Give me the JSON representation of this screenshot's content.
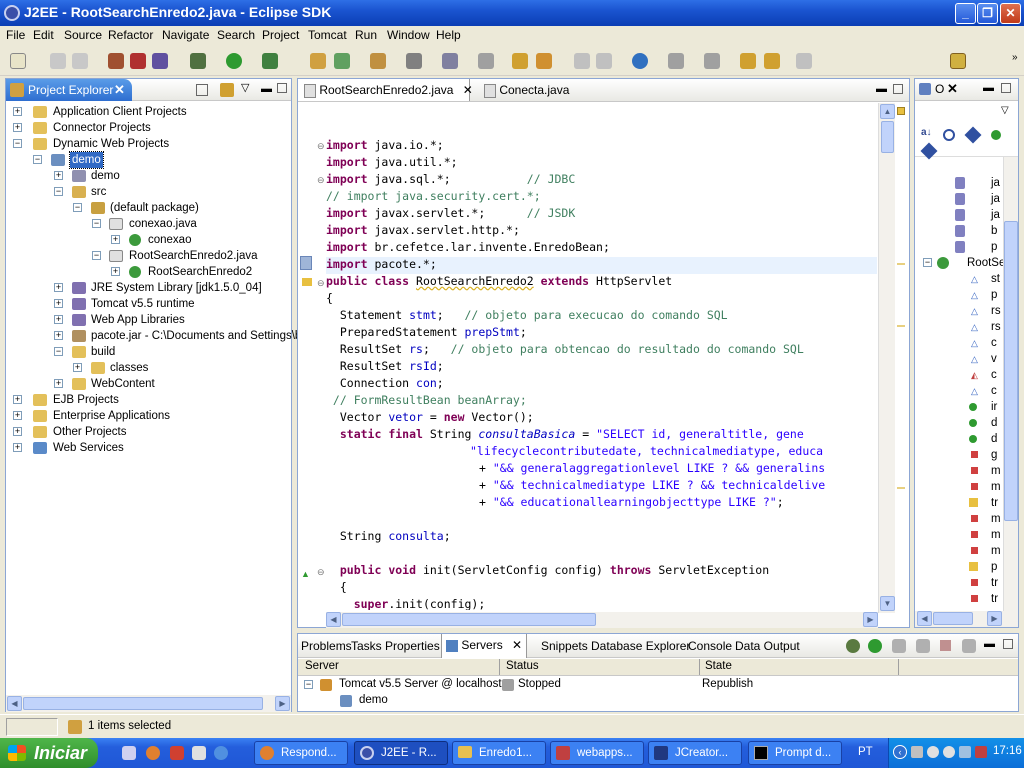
{
  "window": {
    "title": "J2EE - RootSearchEnredo2.java - Eclipse SDK"
  },
  "menu": [
    "File",
    "Edit",
    "Source",
    "Refactor",
    "Navigate",
    "Search",
    "Project",
    "Tomcat",
    "Run",
    "Window",
    "Help"
  ],
  "project_explorer": {
    "title": "Project Explorer",
    "items": [
      {
        "label": "Application Client Projects"
      },
      {
        "label": "Connector Projects"
      },
      {
        "label": "Dynamic Web Projects"
      },
      {
        "label": "demo"
      },
      {
        "label": "demo"
      },
      {
        "label": "src"
      },
      {
        "label": "(default package)"
      },
      {
        "label": "conexao.java"
      },
      {
        "label": "conexao"
      },
      {
        "label": "RootSearchEnredo2.java"
      },
      {
        "label": "RootSearchEnredo2"
      },
      {
        "label": "JRE System Library [jdk1.5.0_04]"
      },
      {
        "label": "Tomcat v5.5 runtime"
      },
      {
        "label": "Web App Libraries"
      },
      {
        "label": "pacote.jar - C:\\Documents and Settings\\br"
      },
      {
        "label": "build"
      },
      {
        "label": "classes"
      },
      {
        "label": "WebContent"
      },
      {
        "label": "EJB Projects"
      },
      {
        "label": "Enterprise Applications"
      },
      {
        "label": "Other Projects"
      },
      {
        "label": "Web Services"
      }
    ]
  },
  "editor": {
    "tabs": [
      {
        "label": "RootSearchEnredo2.java"
      },
      {
        "label": "Conecta.java"
      }
    ]
  },
  "code": {
    "l1": [
      "import",
      " java.io.*;"
    ],
    "l2": [
      "import",
      " java.util.*;"
    ],
    "l3": [
      "import",
      " java.sql.*;           ",
      "// JDBC"
    ],
    "l4": "// import java.security.cert.*;",
    "l5": [
      "import",
      " javax.servlet.*;      ",
      "// JSDK"
    ],
    "l6": [
      "import",
      " javax.servlet.http.*;"
    ],
    "l7": [
      "import",
      " br.cefetce.lar.invente.EnredoBean;"
    ],
    "l8": [
      "import",
      " pacote.*;"
    ],
    "l9": [
      "public class ",
      "RootSearchEnredo2",
      " extends",
      " HttpServlet"
    ],
    "l10": "{",
    "l11": [
      "  Statement ",
      "stmt",
      ";   ",
      "// objeto para execucao do comando SQL"
    ],
    "l12": [
      "  PreparedStatement ",
      "prepStmt",
      ";"
    ],
    "l13": [
      "  ResultSet ",
      "rs",
      ";   ",
      "// objeto para obtencao do resultado do comando SQL"
    ],
    "l14": [
      "  ResultSet ",
      "rsId",
      ";"
    ],
    "l15": [
      "  Connection ",
      "con",
      ";"
    ],
    "l16": " // FormResultBean beanArray;",
    "l17": [
      "  Vector ",
      "vetor",
      " = ",
      "new",
      " Vector();"
    ],
    "l18": [
      "  ",
      "static final",
      " String ",
      "consultaBasica",
      " = ",
      "\"SELECT id, generaltitle, gene"
    ],
    "l19": "\"lifecyclecontributedate, technicalmediatype, educa",
    "l20": [
      "+ ",
      "\"&& generalaggregationlevel LIKE ? && generalins"
    ],
    "l21": [
      "+ ",
      "\"&& technicalmediatype LIKE ? && technicaldelive"
    ],
    "l22": [
      "+ ",
      "\"&& educationallearningobjecttype LIKE ?\"",
      ";"
    ],
    "l23": [
      "  String ",
      "consulta",
      ";"
    ],
    "l24": [
      "  ",
      "public void",
      " init(ServletConfig config) ",
      "throws",
      " ServletException"
    ],
    "l25": "  {",
    "l26": [
      "    ",
      "super",
      ".init(config);"
    ]
  },
  "outline": {
    "title": "O",
    "items": [
      "ja",
      "ja",
      "ja",
      "b",
      "p",
      "RootSe",
      "st",
      "p",
      "rs",
      "rs",
      "c",
      "v",
      "c",
      "c",
      "ir",
      "d",
      "d",
      "g",
      "m",
      "m",
      "tr",
      "m",
      "m",
      "m",
      "p",
      "tr",
      "tr"
    ]
  },
  "bottom": {
    "tabs": [
      {
        "label": "Problems"
      },
      {
        "label": "Tasks"
      },
      {
        "label": "Properties"
      },
      {
        "label": "Servers"
      },
      {
        "label": "Snippets"
      },
      {
        "label": "Database Explorer"
      },
      {
        "label": "Console"
      },
      {
        "label": "Data Output"
      }
    ],
    "columns": [
      "Server",
      "Status",
      "State"
    ],
    "rows": [
      {
        "server": "Tomcat v5.5 Server @ localhost",
        "status": "Stopped",
        "state": "Republish"
      },
      {
        "server": "demo",
        "status": "",
        "state": ""
      }
    ]
  },
  "statusbar": {
    "text": "1 items selected"
  },
  "taskbar": {
    "start": "Iniciar",
    "tasks": [
      {
        "label": "Respond..."
      },
      {
        "label": "J2EE - R..."
      },
      {
        "label": "Enredo1..."
      },
      {
        "label": "webapps..."
      },
      {
        "label": "JCreator..."
      },
      {
        "label": "Prompt d..."
      }
    ],
    "lang": "PT",
    "clock": "17:16"
  }
}
